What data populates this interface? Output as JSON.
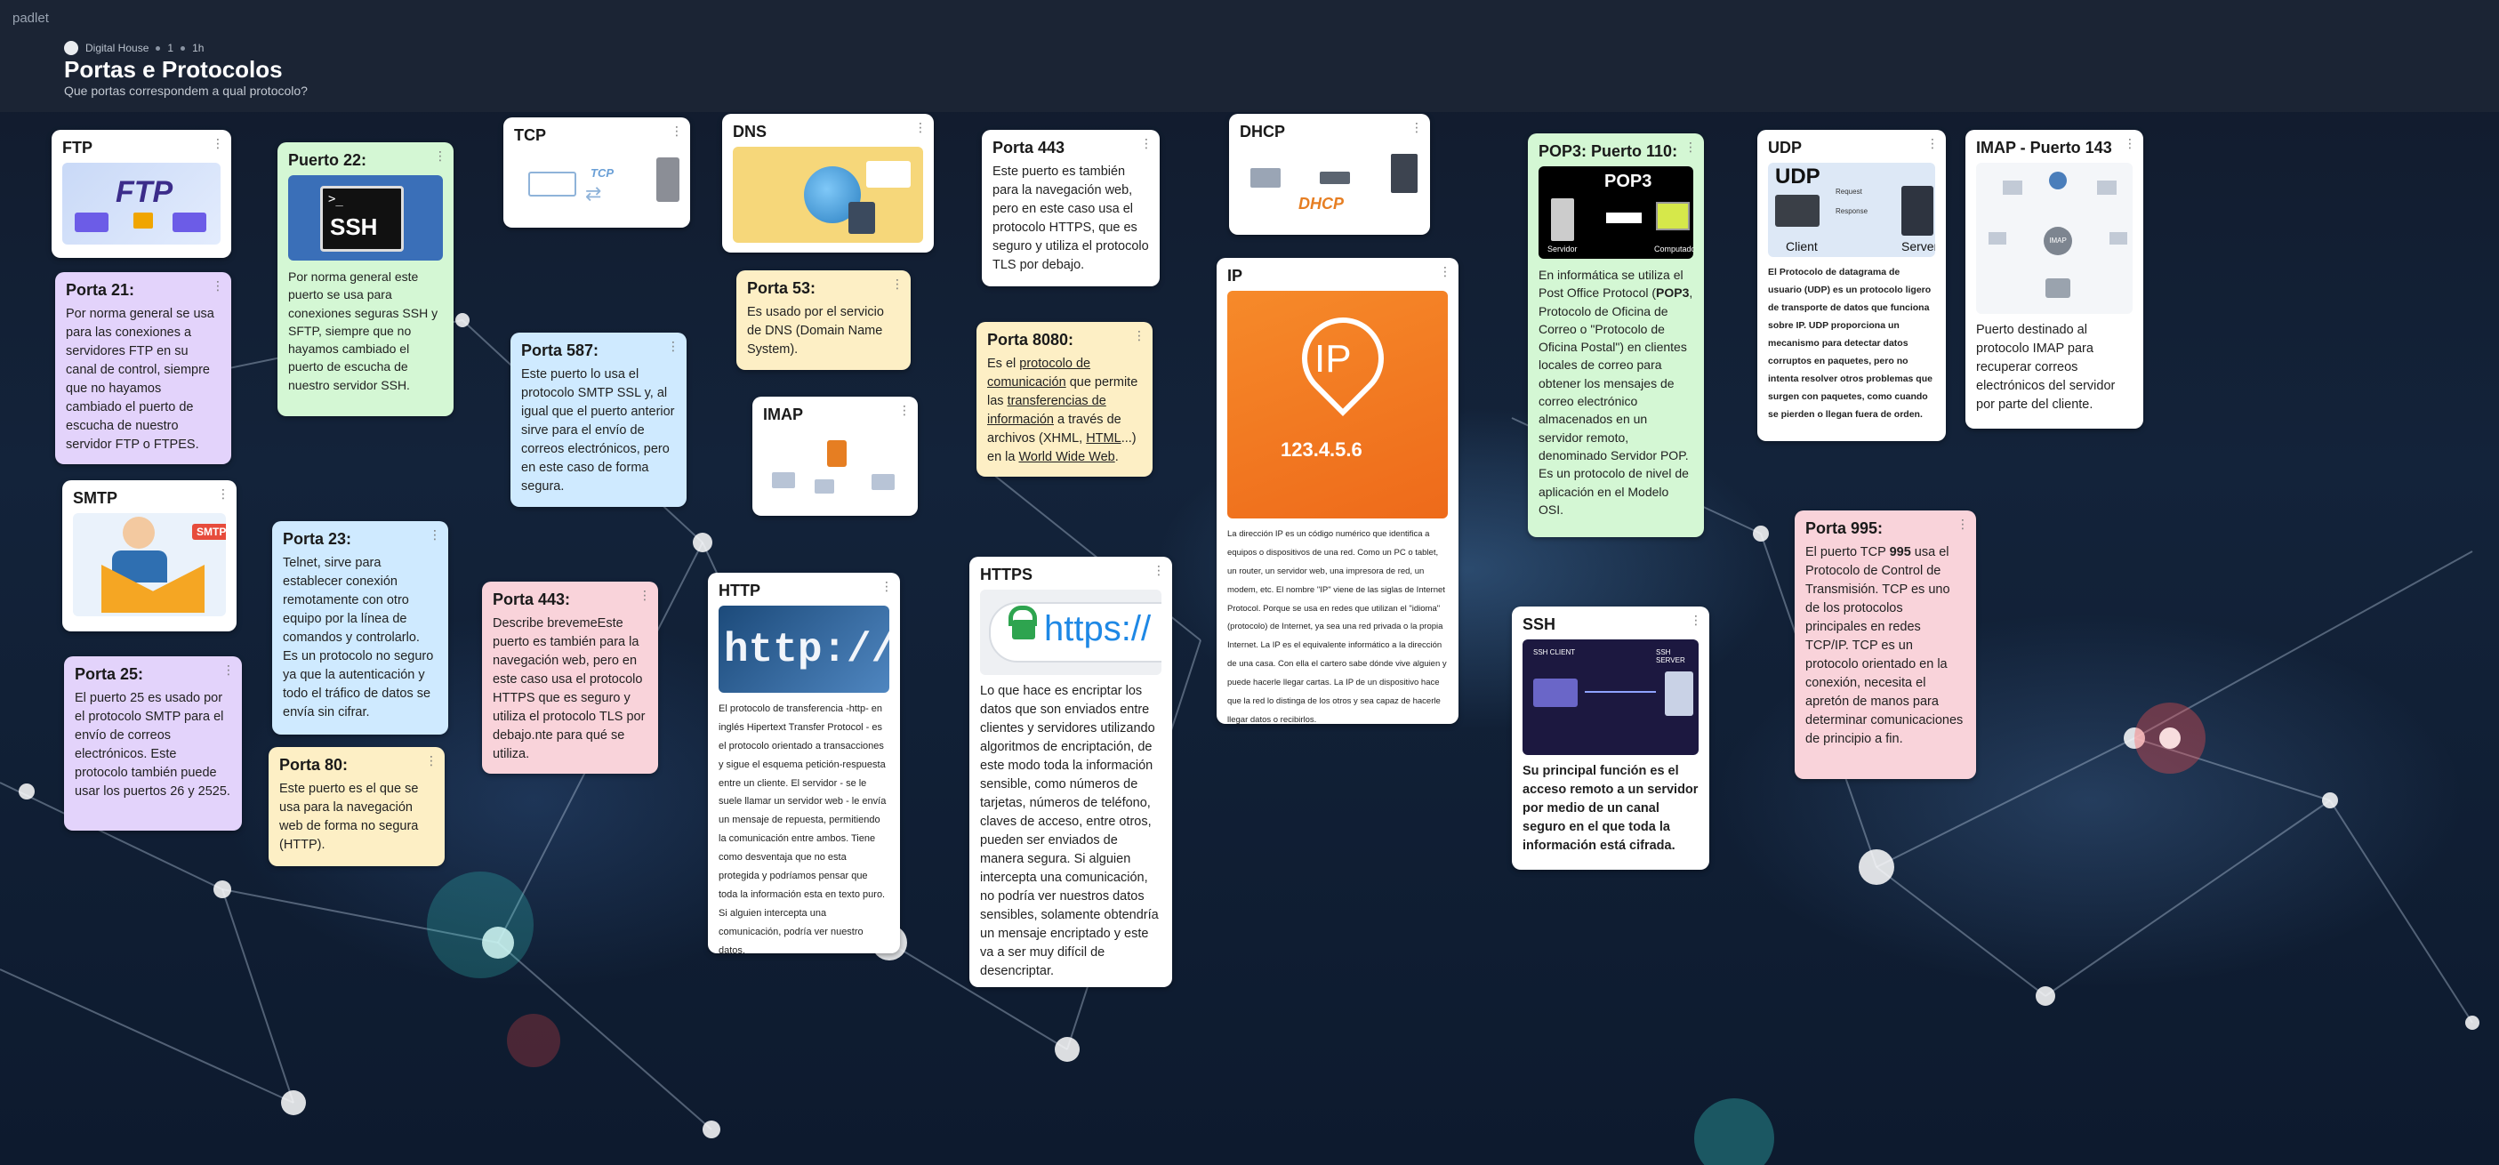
{
  "app": {
    "brand": "padlet",
    "owner": "Digital House",
    "likes": "1",
    "age": "1h"
  },
  "board": {
    "title": "Portas e Protocolos",
    "subtitle": "Que portas correspondem a qual protocolo?"
  },
  "icons": {
    "menu": "kebab-menu-icon"
  },
  "cards": {
    "ftp": {
      "title": "FTP",
      "image_text": "FTP"
    },
    "porta21": {
      "title": "Porta 21:",
      "body": "Por norma general se usa para las conexiones a servidores FTP en su canal de control, siempre que no hayamos cambiado el puerto de escucha de nuestro servidor FTP o FTPES."
    },
    "smtp": {
      "title": "SMTP",
      "image_text": "SMTP"
    },
    "porta25": {
      "title": "Porta 25:",
      "body": "El puerto 25 es usado por el protocolo SMTP para el envío de correos electrónicos. Este protocolo también puede usar los puertos 26 y 2525."
    },
    "puerto22": {
      "title": "Puerto 22:",
      "image_text": "SSH",
      "body": "Por norma general este puerto se usa para conexiones seguras SSH y SFTP, siempre que no hayamos cambiado el puerto de escucha de nuestro servidor SSH."
    },
    "porta23": {
      "title": "Porta 23:",
      "body": "Telnet, sirve para establecer conexión remotamente con otro equipo por la línea de comandos y controlarlo. Es un protocolo no seguro ya que la autenticación y todo el tráfico de datos se envía sin cifrar."
    },
    "porta80": {
      "title": "Porta 80:",
      "body": "Este puerto es el que se usa para la navegación web de forma no segura (HTTP)."
    },
    "tcp": {
      "title": "TCP",
      "image_text": "TCP"
    },
    "porta587": {
      "title": "Porta 587:",
      "body": "Este puerto lo usa el protocolo SMTP SSL y, al igual que el puerto anterior sirve para el envío de correos electrónicos, pero en este caso de forma segura."
    },
    "porta443b": {
      "title": "Porta 443:",
      "body": "Describe brevemeEste puerto es también para la navegación web, pero en este caso usa el protocolo HTTPS que es seguro y utiliza el protocolo TLS por debajo.nte para qué se utiliza."
    },
    "dns": {
      "title": "DNS"
    },
    "porta53": {
      "title": "Porta 53:",
      "body": "Es usado por el servicio de DNS (Domain Name System)."
    },
    "imap": {
      "title": "IMAP"
    },
    "http": {
      "title": "HTTP",
      "image_text": "http://ww",
      "body": "El protocolo de transferencia -http- en inglés Hipertext Transfer  Protocol -  es el protocolo orientado a transacciones y sigue el esquema petición-respuesta entre un cliente. El servidor - se le suele llamar un servidor web - le envía un mensaje de repuesta, permitiendo la comunicación entre ambos. Tiene como desventaja que no esta protegida y podríamos pensar que toda la información esta en texto puro. Si alguien intercepta una comunicación, podría ver nuestro datos."
    },
    "porta443": {
      "title": "Porta 443",
      "body": " Este puerto es también para la navegación web, pero en este caso usa el protocolo HTTPS, que es seguro y utiliza el protocolo TLS por debajo."
    },
    "porta8080": {
      "title": "Porta 8080:",
      "body_a": "Es el ",
      "link_a": "protocolo de comunicación",
      "body_b": " que permite las ",
      "link_b": "transferencias de información",
      "body_c": " a través de archivos (XHML, ",
      "link_c": "HTML",
      "body_d": "...) en la ",
      "link_d": "World Wide Web",
      "body_e": "."
    },
    "https": {
      "title": "HTTPS",
      "image_text": "https://",
      "body": "Lo que hace es encriptar los datos que son enviados entre clientes y servidores utilizando algoritmos de encriptación, de este modo toda la información sensible, como números de tarjetas, números de teléfono, claves de acceso, entre otros, pueden ser enviados de manera segura. Si alguien intercepta una comunicación, no podría ver nuestros datos sensibles, solamente obtendría un mensaje encriptado y este va a ser muy difícil de desencriptar."
    },
    "dhcp": {
      "title": "DHCP",
      "image_text": "DHCP"
    },
    "ip": {
      "title": "IP",
      "image_text": "IP",
      "image_number": "123.4.5.6",
      "body": "La dirección IP es un código numérico que identifica a equipos o dispositivos de una red. Como un PC o tablet, un router, un servidor web, una impresora de red, un modem, etc. El nombre \"IP\" viene de las siglas de Internet Protocol. Porque se usa en redes que utilizan el \"idioma\" (protocolo) de Internet, ya sea una red privada o la propia Internet. La IP es el equivalente informático a la dirección de una casa. Con ella el cartero sabe dónde vive alguien y puede hacerle llegar cartas. La IP de un dispositivo hace que la red lo distinga de los otros y sea capaz de hacerle llegar datos o recibirlos."
    },
    "pop3": {
      "title": "POP3: Puerto 110:",
      "image_text": "POP3",
      "image_left": "Servidor",
      "image_right": "Computador",
      "body_a": "En informática se utiliza el Post Office Protocol (",
      "body_bold": "POP3",
      "body_b": ", Protocolo de Oficina de Correo o \"Protocolo de Oficina Postal\") en clientes locales de correo para obtener los mensajes de correo electrónico almacenados en un servidor remoto, denominado Servidor POP. Es un protocolo de nivel de aplicación en el Modelo OSI."
    },
    "ssh": {
      "title": "SSH",
      "image_left": "SSH CLIENT",
      "image_right": "SSH SERVER",
      "body": "Su principal función es el acceso remoto a un servidor por medio de un canal seguro en el que toda la información está cifrada."
    },
    "udp": {
      "title": "UDP",
      "image_text": "UDP",
      "image_left": "Client",
      "image_right": "Server",
      "image_req": "Request",
      "image_resp": "Response",
      "body": "El Protocolo de datagrama de usuario (UDP) es un protocolo ligero de transporte de datos que funciona sobre IP. UDP proporciona un mecanismo para detectar datos corruptos en paquetes, pero no intenta resolver otros problemas que surgen con paquetes, como cuando se pierden o llegan fuera de orden."
    },
    "porta995": {
      "title": "Porta 995:",
      "body_a": "El puerto TCP ",
      "body_bold": "995",
      "body_b": " usa el Protocolo de Control de Transmisión. TCP es uno de los protocolos principales en redes TCP/IP. TCP es un protocolo orientado en la conexión, necesita el apretón de manos para determinar comunicaciones de principio a fin."
    },
    "imap143": {
      "title": "IMAP - Puerto 143",
      "image_center": "IMAP",
      "body": "Puerto destinado al protocolo IMAP para recuperar correos electrónicos del servidor por parte del cliente."
    }
  }
}
